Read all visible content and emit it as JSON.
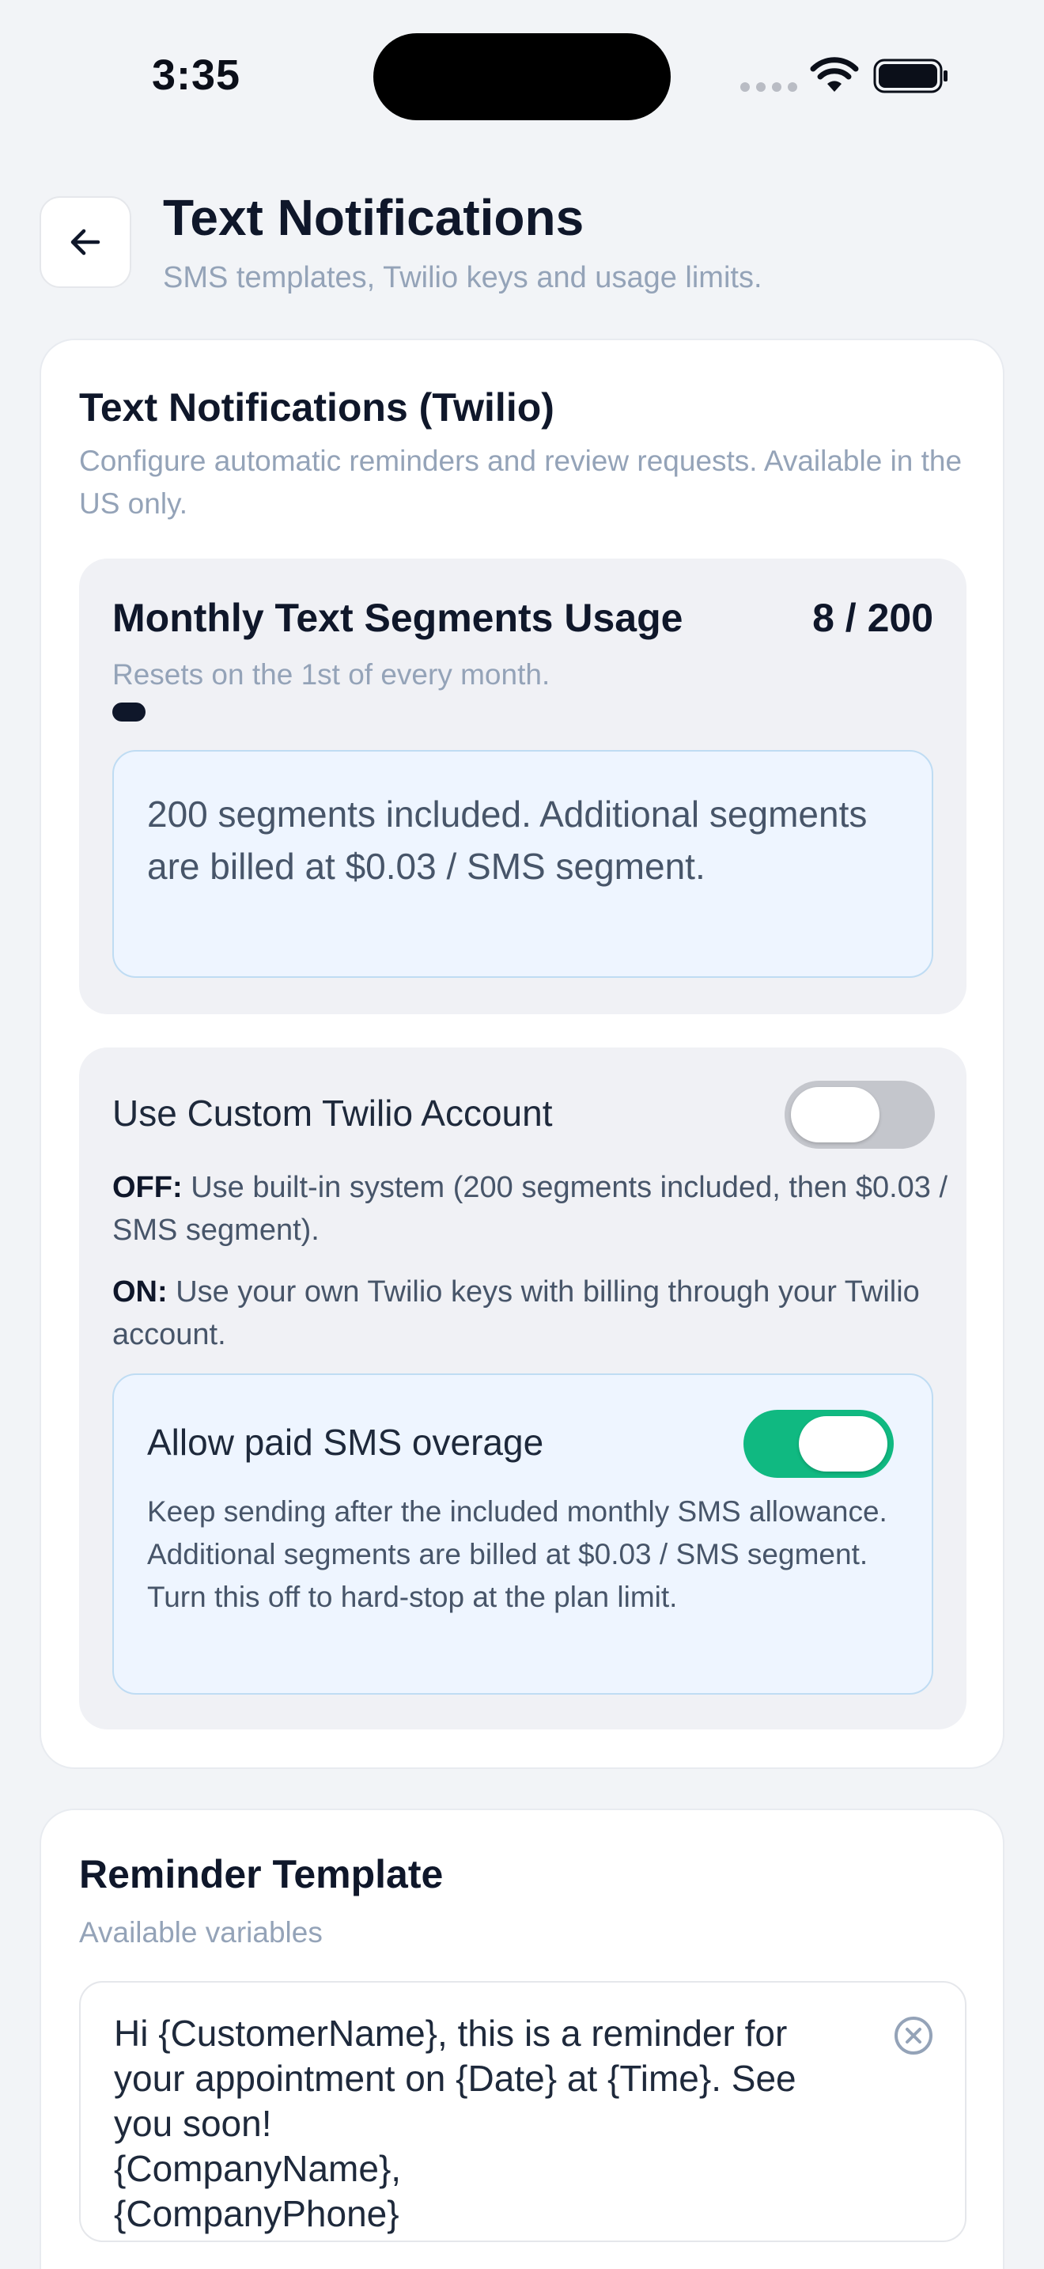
{
  "status_bar": {
    "time": "3:35",
    "icons": [
      "signal-dots-icon",
      "wifi-icon",
      "battery-icon"
    ]
  },
  "header": {
    "back_icon": "arrow-left-icon",
    "title": "Text Notifications",
    "subtitle": "SMS templates, Twilio keys and usage limits."
  },
  "twilio_card": {
    "title": "Text Notifications (Twilio)",
    "description": "Configure automatic reminders and review requests. Available in the US only.",
    "usage": {
      "title": "Monthly Text Segments Usage",
      "count_text": "8 / 200",
      "used": 8,
      "limit": 200,
      "reset_text": "Resets on the 1st of every month.",
      "info": "200 segments included. Additional segments are billed at $0.03 / SMS segment."
    },
    "custom_account": {
      "label": "Use Custom Twilio Account",
      "enabled": false,
      "off_label": "OFF:",
      "off_text": "Use built-in system (200 segments included, then $0.03 / SMS segment).",
      "on_label": "ON:",
      "on_text": "Use your own Twilio keys with billing through your Twilio account."
    },
    "overage": {
      "label": "Allow paid SMS overage",
      "enabled": true,
      "description": "Keep sending after the included monthly SMS allowance. Additional segments are billed at $0.03 / SMS segment. Turn this off to hard-stop at the plan limit."
    }
  },
  "template_card": {
    "title": "Reminder Template",
    "variables_label": "Available variables",
    "text_lines": [
      "Hi {CustomerName}, this is a reminder for",
      "your appointment on {Date} at {Time}. See",
      "you soon!",
      "{CompanyName},",
      "{CompanyPhone}"
    ],
    "clear_icon": "clear-circle-x-icon"
  },
  "colors": {
    "background": "#f2f4f7",
    "card": "#ffffff",
    "panel": "#f0f1f5",
    "info_box": "#eef5ff",
    "toggle_on": "#10b981",
    "toggle_off": "#c4c6cc",
    "text_primary": "#0f172a",
    "text_muted": "#94a3b8"
  }
}
